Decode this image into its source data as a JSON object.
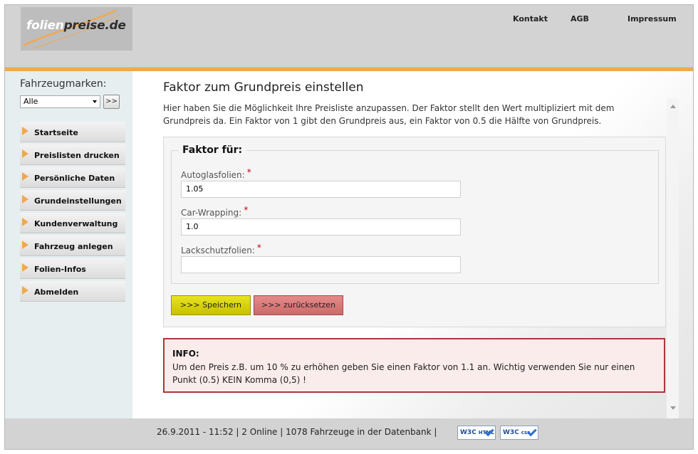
{
  "header": {
    "logo": {
      "part1": "folien",
      "part2": "preise.de"
    },
    "nav": [
      "Kontakt",
      "AGB",
      "Impressum"
    ]
  },
  "sidebar": {
    "brand_label": "Fahrzeugmarken:",
    "brand_select_value": "Alle",
    "brand_go_label": ">>",
    "menu": [
      "Startseite",
      "Preislisten drucken",
      "Persönliche Daten",
      "Grundeinstellungen",
      "Kundenverwaltung",
      "Fahrzeug anlegen",
      "Folien-Infos",
      "Abmelden"
    ]
  },
  "main": {
    "title": "Faktor zum Grundpreis einstellen",
    "intro": "Hier haben Sie die Möglichkeit Ihre Preisliste anzupassen. Der Faktor stellt den Wert multipliziert mit dem Grundpreis da. Ein Faktor von 1 gibt den Grundpreis aus, ein Faktor von 0.5 die Hälfte von Grundpreis.",
    "form": {
      "legend": "Faktor für:",
      "required_mark": "*",
      "fields": [
        {
          "label": "Autoglasfolien:",
          "value": "1.05"
        },
        {
          "label": "Car-Wrapping:",
          "value": "1.0"
        },
        {
          "label": "Lackschutzfolien:",
          "value": ""
        }
      ],
      "save_label": ">>> Speichern",
      "reset_label": ">>> zurücksetzen"
    },
    "info": {
      "title": "INFO:",
      "text": "Um den Preis z.B. um 10 % zu erhöhen geben Sie einen Faktor von 1.1 an. Wichtig verwenden Sie nur einen Punkt (0.5) KEIN Komma (0,5) !"
    }
  },
  "footer": {
    "status": "26.9.2011 - 11:52 | 2 Online | 1078 Fahrzeuge in der Datenbank |",
    "badge_html": {
      "main": "W3C",
      "sub": "HTML 4.01"
    },
    "badge_css": {
      "main": "W3C",
      "sub": "css"
    }
  },
  "colors": {
    "accent_orange": "#f0a850",
    "save_button": "#d8d210",
    "reset_button": "#d87878",
    "info_border": "#a83838"
  }
}
